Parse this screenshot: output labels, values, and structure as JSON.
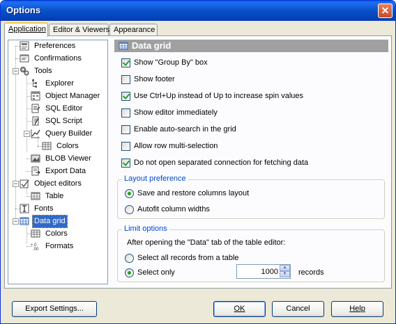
{
  "window": {
    "title": "Options",
    "close_glyph": "✕"
  },
  "tabs": [
    {
      "label": "Application",
      "active": true
    },
    {
      "label": "Editor & Viewers",
      "active": false
    },
    {
      "label": "Appearance",
      "active": false
    }
  ],
  "tree": {
    "items": [
      {
        "label": "Preferences",
        "icon": "preferences-icon"
      },
      {
        "label": "Confirmations",
        "icon": "confirmations-icon"
      },
      {
        "label": "Tools",
        "icon": "tools-icon",
        "expanded": true
      },
      {
        "label": "Explorer",
        "icon": "explorer-icon"
      },
      {
        "label": "Object Manager",
        "icon": "object-manager-icon"
      },
      {
        "label": "SQL Editor",
        "icon": "sql-editor-icon"
      },
      {
        "label": "SQL Script",
        "icon": "sql-script-icon"
      },
      {
        "label": "Query Builder",
        "icon": "query-builder-icon",
        "expanded": true
      },
      {
        "label": "Colors",
        "icon": "colors-icon"
      },
      {
        "label": "BLOB Viewer",
        "icon": "blob-viewer-icon"
      },
      {
        "label": "Export Data",
        "icon": "export-data-icon"
      },
      {
        "label": "Object editors",
        "icon": "object-editors-icon",
        "expanded": true
      },
      {
        "label": "Table",
        "icon": "table-icon"
      },
      {
        "label": "Fonts",
        "icon": "fonts-icon"
      },
      {
        "label": "Data grid",
        "icon": "data-grid-icon",
        "expanded": true,
        "selected": true
      },
      {
        "label": "Colors",
        "icon": "colors-icon"
      },
      {
        "label": "Formats",
        "icon": "formats-icon"
      }
    ]
  },
  "pane": {
    "title": "Data grid",
    "checkboxes": [
      {
        "label": "Show \"Group By\" box",
        "checked": true
      },
      {
        "label": "Show footer",
        "checked": false
      },
      {
        "label": "Use Ctrl+Up instead of Up to increase spin values",
        "checked": true
      },
      {
        "label": "Show editor immediately",
        "checked": false
      },
      {
        "label": "Enable auto-search in the grid",
        "checked": false
      },
      {
        "label": "Allow row multi-selection",
        "checked": false
      },
      {
        "label": "Do not open separated connection for fetching data",
        "checked": true
      }
    ],
    "layout_group": {
      "title": "Layout preference",
      "options": [
        {
          "label": "Save and restore columns layout",
          "selected": true
        },
        {
          "label": "Autofit column widths",
          "selected": false
        }
      ]
    },
    "limit_group": {
      "title": "Limit options",
      "description": "After opening the \"Data\" tab of the table editor:",
      "options": [
        {
          "label": "Select all records from a table",
          "selected": false
        },
        {
          "label": "Select only",
          "selected": true
        }
      ],
      "record_count": "1000",
      "records_label": "records"
    }
  },
  "buttons": {
    "export_settings": "Export Settings...",
    "ok": "OK",
    "cancel": "Cancel",
    "help": "Help"
  }
}
